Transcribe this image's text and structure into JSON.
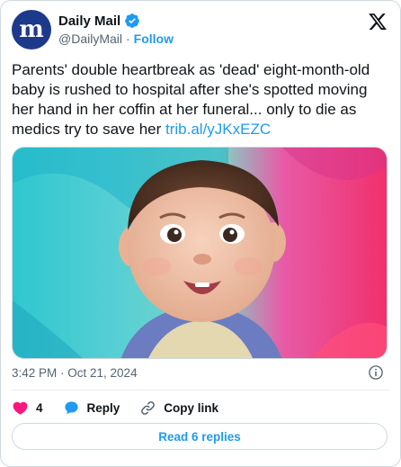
{
  "account": {
    "display_name": "Daily Mail",
    "handle": "@DailyMail",
    "separator": "·",
    "follow_label": "Follow",
    "avatar_letter": "m"
  },
  "tweet": {
    "text": "Parents' double heartbreak as 'dead' eight-month-old baby is rushed to hospital after she's spotted moving her hand in her coffin at her funeral... only to die as medics try to save her ",
    "link": "trib.al/yJKxEZC",
    "timestamp": "3:42 PM · Oct 21, 2024"
  },
  "actions": {
    "like_count": "4",
    "reply_label": "Reply",
    "copy_link_label": "Copy link"
  },
  "read_replies_label": "Read 6 replies",
  "icons": {
    "verified": "verified-badge-icon",
    "logo": "x-logo-icon",
    "info": "info-icon",
    "like": "heart-icon",
    "reply": "reply-bubble-icon",
    "copy": "link-icon"
  },
  "colors": {
    "accent": "#1d9bf0",
    "like": "#f91880",
    "muted": "#536471",
    "brand": "#1d3a8a"
  }
}
